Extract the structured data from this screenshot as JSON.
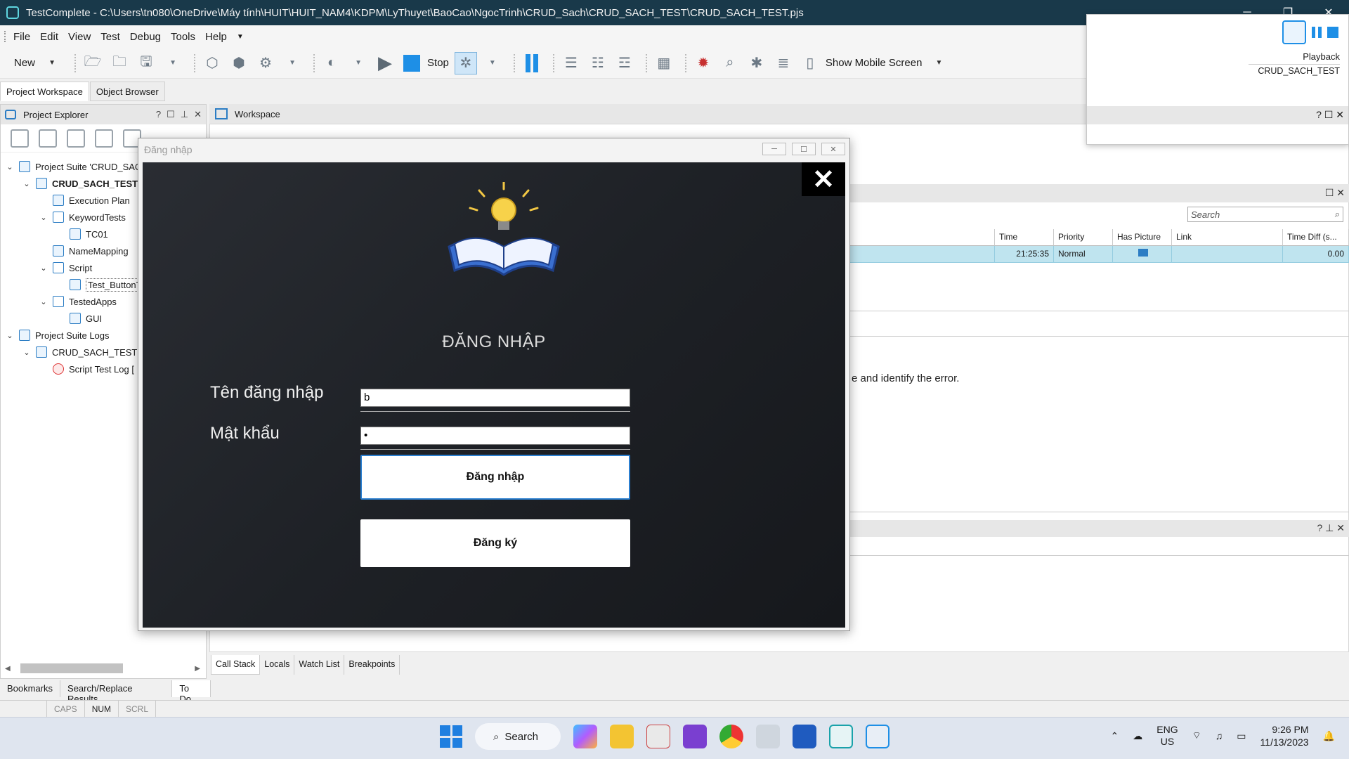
{
  "window": {
    "title": "TestComplete - C:\\Users\\tn080\\OneDrive\\Máy tính\\HUIT\\HUIT_NAM4\\KDPM\\LyThuyet\\BaoCao\\NgocTrinh\\CRUD_Sach\\CRUD_SACH_TEST\\CRUD_SACH_TEST.pjs"
  },
  "menu": {
    "file": "File",
    "edit": "Edit",
    "view": "View",
    "test": "Test",
    "debug": "Debug",
    "tools": "Tools",
    "help": "Help"
  },
  "toolbar": {
    "new_label": "New",
    "stop_label": "Stop",
    "mobile_label": "Show Mobile Screen"
  },
  "left_tabs": [
    "Project Workspace",
    "Object Browser"
  ],
  "project_explorer": {
    "title": "Project Explorer",
    "tree": [
      {
        "label": "Project Suite 'CRUD_SAC",
        "level": 0
      },
      {
        "label": "CRUD_SACH_TEST",
        "level": 1
      },
      {
        "label": "Execution Plan",
        "level": 2
      },
      {
        "label": "KeywordTests",
        "level": 2
      },
      {
        "label": "TC01",
        "level": 3
      },
      {
        "label": "NameMapping",
        "level": 2
      },
      {
        "label": "Script",
        "level": 2
      },
      {
        "label": "Test_ButtonT",
        "level": 3
      },
      {
        "label": "TestedApps",
        "level": 2
      },
      {
        "label": "GUI",
        "level": 3
      },
      {
        "label": "Project Suite Logs",
        "level": 0
      },
      {
        "label": "CRUD_SACH_TEST L",
        "level": 1
      },
      {
        "label": "Script Test Log [",
        "level": 2
      }
    ]
  },
  "bottom_left_tabs": [
    "Bookmarks",
    "Search/Replace Results",
    "To Do"
  ],
  "status_bar": [
    "CAPS",
    "NUM",
    "SCRL"
  ],
  "workspace": {
    "title": "Workspace",
    "search_placeholder": "Search",
    "log_columns": [
      "Time",
      "Priority",
      "Has Picture",
      "Link",
      "Time Diff (s..."
    ],
    "log_row": {
      "time": "21:25:35",
      "priority": "Normal",
      "link": "",
      "time_diff": "0.00"
    },
    "error_text": "e and identify the error."
  },
  "debug_tabs": [
    "Call Stack",
    "Locals",
    "Watch List",
    "Breakpoints"
  ],
  "playback": {
    "label": "Playback",
    "project": "CRUD_SACH_TEST"
  },
  "login": {
    "window_title": "Đăng nhập",
    "heading": "ĐĂNG NHẬP",
    "username_label": "Tên đăng nhập",
    "username_value": "b",
    "password_label": "Mật khẩu",
    "password_value": "•",
    "login_button": "Đăng nhập",
    "register_button": "Đăng ký",
    "close_glyph": "✕"
  },
  "taskbar": {
    "search_label": "Search",
    "lang_line1": "ENG",
    "lang_line2": "US",
    "time": "9:26 PM",
    "date": "11/13/2023"
  },
  "colors": {
    "title_bar": "#19394a",
    "accent": "#1e8fe6",
    "log_row_highlight": "#bfe4ef",
    "login_background": "#1e2126"
  }
}
